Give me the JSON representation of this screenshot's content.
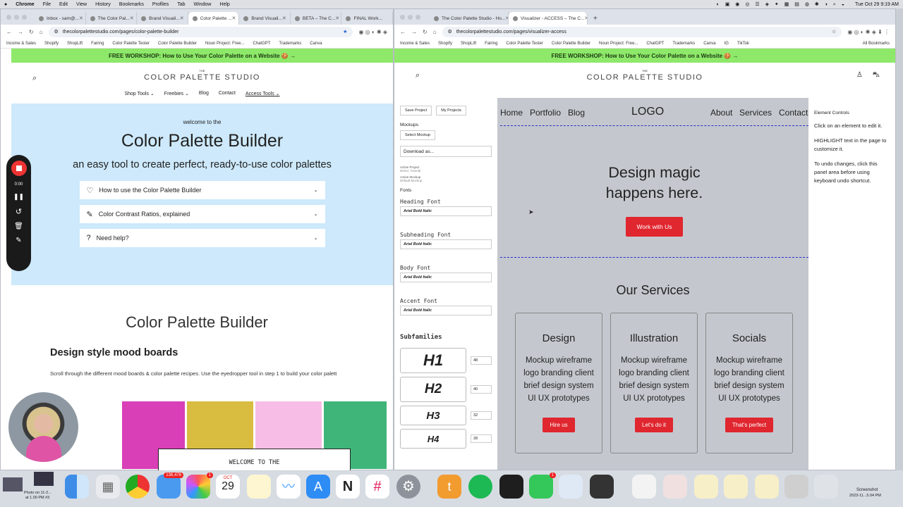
{
  "menubar": {
    "app": "Chrome",
    "items": [
      "File",
      "Edit",
      "View",
      "History",
      "Bookmarks",
      "Profiles",
      "Tab",
      "Window",
      "Help"
    ],
    "clock": "Tue Oct 29  9:19 AM"
  },
  "left_window": {
    "tabs": [
      "Inbox - sam@...",
      "The Color Pal...",
      "Brand Visuali...",
      "Color Palette ...",
      "Brand Visuali...",
      "BETA – The C...",
      "FINAL Work..."
    ],
    "url": "thecolorpalettestudio.com/pages/color-palette-builder",
    "bookmarks": [
      "Income & Sales",
      "Shopify",
      "ShopLift",
      "Fairing",
      "Color Palette Tester",
      "Color Palette Builder",
      "Noun Project: Free...",
      "ChatGPT",
      "Trademarks",
      "Canva"
    ],
    "banner": "FREE WORKSHOP: How to Use Your Color Palette on a Website 🍪 →",
    "logo_small": "THE",
    "logo": "COLOR PALETTE STUDIO",
    "nav": [
      "Shop Tools ⌄",
      "Freebies ⌄",
      "Blog",
      "Contact",
      "Access Tools ⌄"
    ],
    "welcome": "welcome to the",
    "title": "Color Palette Builder",
    "subtitle": "an easy tool to create perfect, ready-to-use color palettes",
    "accordions": [
      "How to use the Color Palette Builder",
      "Color Contrast Ratios, explained",
      "Need help?"
    ],
    "section_title": "Color Palette Builder",
    "mood_title": "Design style mood boards",
    "mood_text": "Scroll through the different mood boards & color palette recipes. Use the eyedropper tool in step 1 to build your color palett",
    "welcome_box": "WELCOME TO THE",
    "rec_time": "0:00",
    "swatches": [
      "#d93fb7",
      "#d8bd40",
      "#f7bde6",
      "#3fb57a"
    ]
  },
  "right_window": {
    "tabs": [
      "The Color Palette Studio - Ho...",
      "Visualizer - ACCESS – The C..."
    ],
    "url": "thecolorpalettestudio.com/pages/visualizer-access",
    "bookmarks": [
      "Income & Sales",
      "Shopify",
      "ShopLift",
      "Fairing",
      "Color Palette Tester",
      "Color Palette Builder",
      "Noun Project: Free...",
      "ChatGPT",
      "Trademarks",
      "Canva",
      "IG",
      "TikTok"
    ],
    "all_bookmarks": "All Bookmarks",
    "banner": "FREE WORKSHOP: How to Use Your Color Palette on a Website 🍪 →",
    "logo": "COLOR PALETTE STUDIO",
    "panel": {
      "save": "Save Project",
      "projects": "My Projects",
      "mockups": "Mockups",
      "select_mockup": "Select Mockup",
      "download": "Download as...",
      "active_project": "Active Project",
      "active_project_val": "Demo: Tutorial",
      "active_mockup": "Active Mockup",
      "active_mockup_val": "Default Mockup",
      "fonts": "Fonts",
      "font_rows": [
        {
          "label": "Heading Font",
          "value": "Arial Bold Italic"
        },
        {
          "label": "Subheading Font",
          "value": "Arial Bold Italic"
        },
        {
          "label": "Body Font",
          "value": "Arial Bold Italic"
        },
        {
          "label": "Accent Font",
          "value": "Arial Bold Italic"
        }
      ],
      "subfamilies": "Subfamilies",
      "headings": [
        {
          "tag": "H1",
          "size": "48"
        },
        {
          "tag": "H2",
          "size": "40"
        },
        {
          "tag": "H3",
          "size": "32"
        },
        {
          "tag": "H4",
          "size": "28"
        }
      ]
    },
    "mock": {
      "nav_left": [
        "Home",
        "Portfolio",
        "Blog"
      ],
      "logo": "LOGO",
      "nav_right": [
        "About",
        "Services",
        "Contact"
      ],
      "hero": "Design magic happens here.",
      "hero_btn": "Work with Us",
      "services_title": "Our Services",
      "cards": [
        {
          "title": "Design",
          "text": "Mockup wireframe logo branding client brief design system UI UX prototypes",
          "btn": "Hire us"
        },
        {
          "title": "Illustration",
          "text": "Mockup wireframe logo branding client brief design system UI UX prototypes",
          "btn": "Let's do it"
        },
        {
          "title": "Socials",
          "text": "Mockup wireframe logo branding client brief design system UI UX prototypes",
          "btn": "That's perfect"
        }
      ]
    },
    "controls": {
      "title": "Element Controls",
      "p1": "Click on an element to edit it.",
      "p2": "HIGHLIGHT text in the page to customize it.",
      "p3": "To undo changes, click this panel area before using keyboard undo shortcut."
    }
  },
  "dock": {
    "mail_badge": "136,476",
    "photos_badge": "1",
    "cal_month": "OCT",
    "cal_day": "29",
    "messages_badge": "1",
    "screenshot_label": "Screenshot",
    "screenshot_date": "2023-11...5.04 PM",
    "photo_label": "Photo on 11-2...",
    "photo_time": "at 1.00 PM #3"
  },
  "colors": {
    "banner": "#8ee86a",
    "accent_red": "#e0262f",
    "builder_bg": "#cde9fb",
    "mock_bg": "#c4c8ce"
  }
}
